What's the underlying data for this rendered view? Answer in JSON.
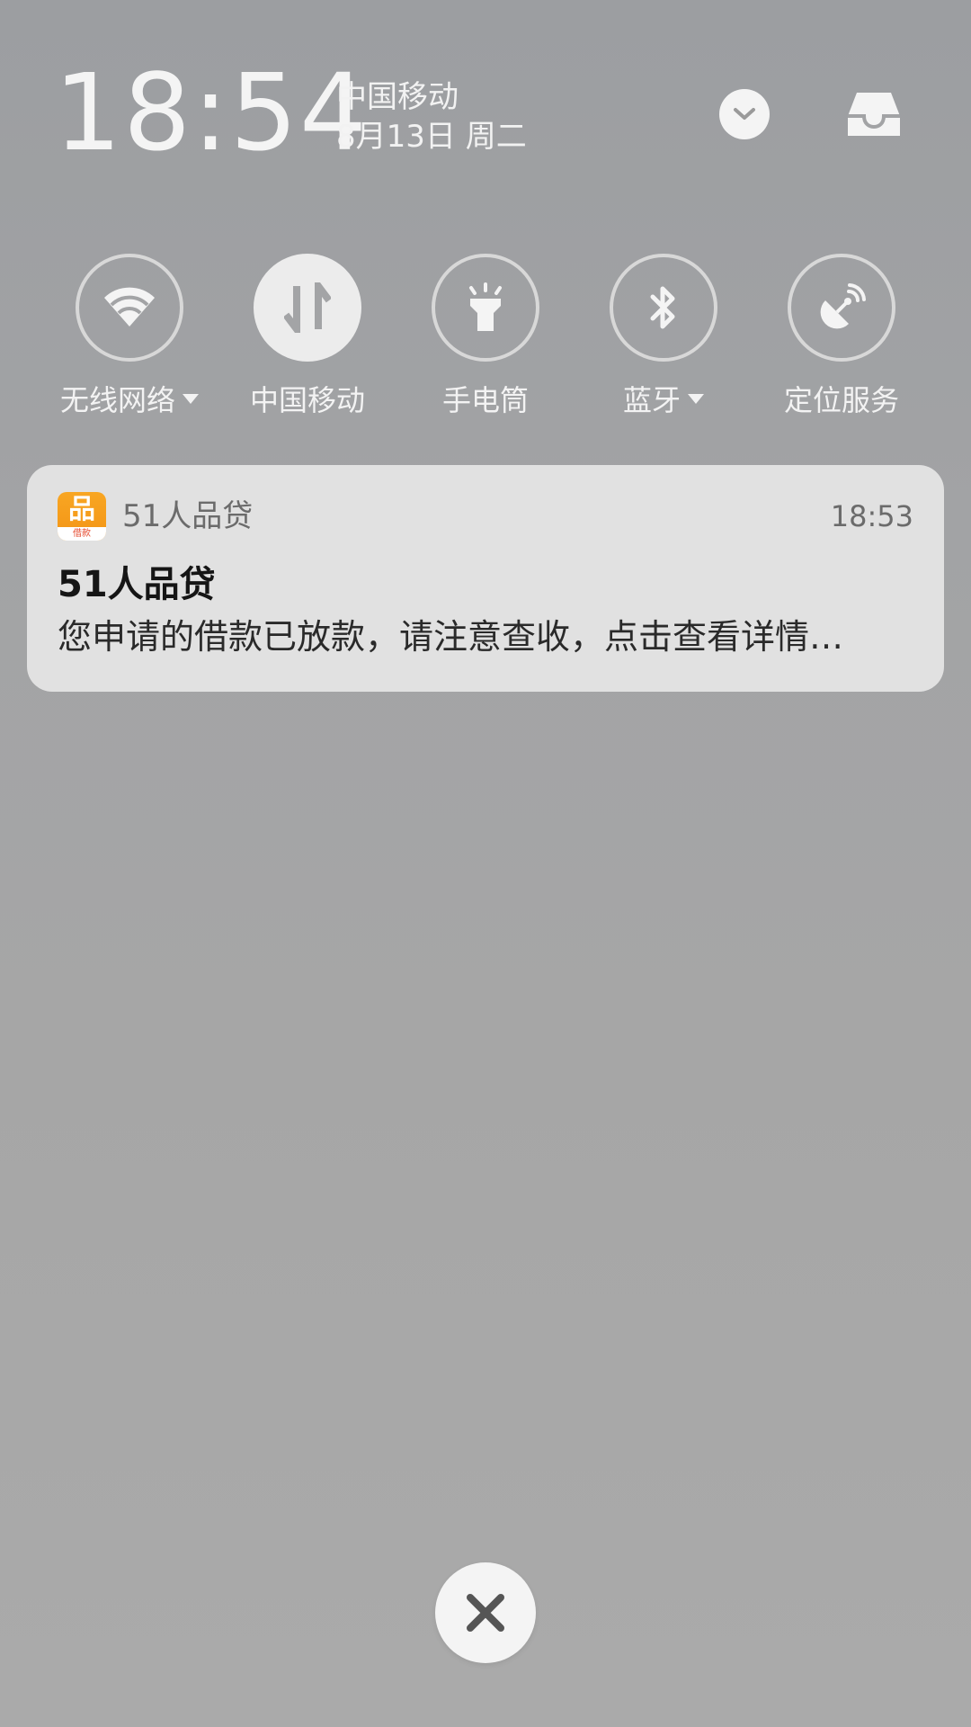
{
  "status": {
    "time": "18:54",
    "carrier": "中国移动",
    "date": "8月13日 周二"
  },
  "quick_toggles": [
    {
      "label": "无线网络",
      "icon": "wifi-icon",
      "active": false,
      "has_menu": true
    },
    {
      "label": "中国移动",
      "icon": "mobile-data-icon",
      "active": true,
      "has_menu": false
    },
    {
      "label": "手电筒",
      "icon": "flashlight-icon",
      "active": false,
      "has_menu": false
    },
    {
      "label": "蓝牙",
      "icon": "bluetooth-icon",
      "active": false,
      "has_menu": true
    },
    {
      "label": "定位服务",
      "icon": "location-icon",
      "active": false,
      "has_menu": false
    }
  ],
  "notification": {
    "app_name": "51人品贷",
    "time": "18:53",
    "title": "51人品贷",
    "body": "您申请的借款已放款，请注意查收，点击查看详情…",
    "icon_glyph": "品",
    "icon_band": "借款",
    "icon_color": "#f39c1c"
  },
  "colors": {
    "background": "#a4a5a6",
    "card": "#e1e1e1",
    "text_light": "#f3f3f3"
  }
}
